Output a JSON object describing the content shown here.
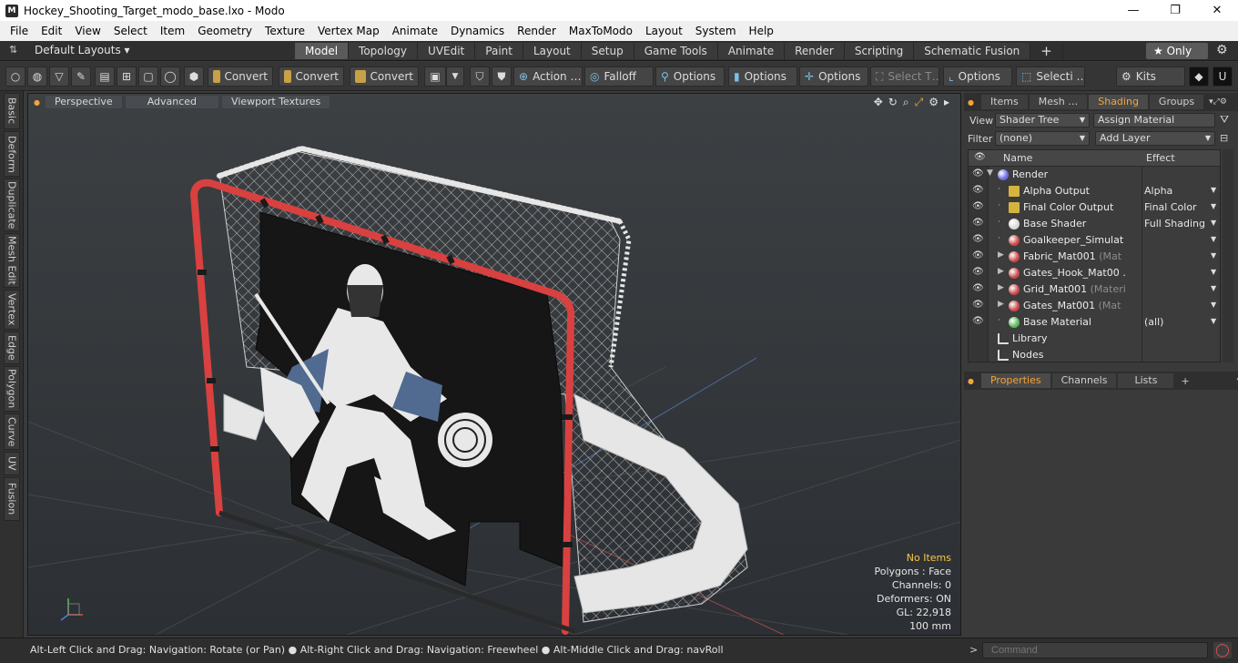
{
  "window": {
    "title": "Hockey_Shooting_Target_modo_base.lxo - Modo",
    "controls": [
      "—",
      "❐",
      "✕"
    ]
  },
  "menu": [
    "File",
    "Edit",
    "View",
    "Select",
    "Item",
    "Geometry",
    "Texture",
    "Vertex Map",
    "Animate",
    "Dynamics",
    "Render",
    "MaxToModo",
    "Layout",
    "System",
    "Help"
  ],
  "layout": {
    "label": "Default Layouts ▾",
    "tabs": [
      "Model",
      "Topology",
      "UVEdit",
      "Paint",
      "Layout",
      "Setup",
      "Game Tools",
      "Animate",
      "Render",
      "Scripting",
      "Schematic Fusion"
    ],
    "active_tab": "Model",
    "add": "+",
    "only_label": "★ Only"
  },
  "toolbar": {
    "convert1": "Convert",
    "convert2": "Convert",
    "convert3": "Convert",
    "action": "Action …",
    "falloff": "Falloff",
    "options1": "Options",
    "options2": "Options",
    "options3": "Options",
    "select": "Select T…",
    "options4": "Options",
    "selecti": "Selecti …",
    "kits": "Kits"
  },
  "left_tabs": [
    "Basic",
    "Deform",
    "Duplicate",
    "Mesh Edit",
    "Vertex",
    "Edge",
    "Polygon",
    "Curve",
    "UV",
    "Fusion"
  ],
  "viewport": {
    "tabs": [
      "Perspective",
      "Advanced",
      "Viewport Textures"
    ],
    "hud": {
      "no_items": "No Items",
      "polygons": "Polygons : Face",
      "channels": "Channels: 0",
      "deformers": "Deformers: ON",
      "gl": "GL: 22,918",
      "scale": "100 mm"
    }
  },
  "status": {
    "hint": "Alt-Left Click and Drag: Navigation: Rotate (or Pan) ● Alt-Right Click and Drag: Navigation: Freewheel ● Alt-Middle Click and Drag: navRoll",
    "command_placeholder": "Command"
  },
  "right_panel": {
    "top_tabs": [
      "Items",
      "Mesh …",
      "Shading",
      "Groups"
    ],
    "active_top_tab": "Shading",
    "view_label": "View",
    "view_value": "Shader Tree",
    "assign_material": "Assign Material",
    "filter_label": "Filter",
    "filter_value": "(none)",
    "add_layer": "Add Layer",
    "columns": {
      "name": "Name",
      "effect": "Effect"
    },
    "rows": [
      {
        "name": "Render",
        "sub": "",
        "effect": "",
        "icon": "#6a6adf",
        "level": 0
      },
      {
        "name": "Alpha Output",
        "sub": "",
        "effect": "Alpha",
        "icon": "#d4b43c",
        "level": 1
      },
      {
        "name": "Final Color Output",
        "sub": "",
        "effect": "Final Color",
        "icon": "#d4b43c",
        "level": 1
      },
      {
        "name": "Base Shader",
        "sub": "",
        "effect": "Full Shading",
        "icon": "#d8d8d8",
        "level": 1
      },
      {
        "name": "Goalkeeper_Simulat …",
        "sub": "",
        "effect": "",
        "icon": "#c84848",
        "level": 1
      },
      {
        "name": "Fabric_Mat001",
        "sub": " (Mat …",
        "effect": "",
        "icon": "#c84848",
        "level": 1
      },
      {
        "name": "Gates_Hook_Mat00 …",
        "sub": "",
        "effect": "",
        "icon": "#c84848",
        "level": 1
      },
      {
        "name": "Grid_Mat001",
        "sub": " (Material)",
        "effect": "",
        "icon": "#c84848",
        "level": 1
      },
      {
        "name": "Gates_Mat001",
        "sub": " (Mat …",
        "effect": "",
        "icon": "#c84848",
        "level": 1
      },
      {
        "name": "Base Material",
        "sub": "",
        "effect": "(all)",
        "icon": "#58b858",
        "level": 1
      },
      {
        "name": "Library",
        "sub": "",
        "effect": "",
        "icon": "folder",
        "level": 0
      },
      {
        "name": "Nodes",
        "sub": "",
        "effect": "",
        "icon": "folder",
        "level": 0
      }
    ],
    "bottom_tabs": [
      "Properties",
      "Channels",
      "Lists"
    ],
    "active_bottom_tab": "Properties"
  },
  "colors": {
    "accent": "#f2a43a",
    "frame_red": "#d8413f",
    "net_white": "#f0f0f0",
    "target_black": "#151515",
    "goalie_blue": "#506a90"
  }
}
